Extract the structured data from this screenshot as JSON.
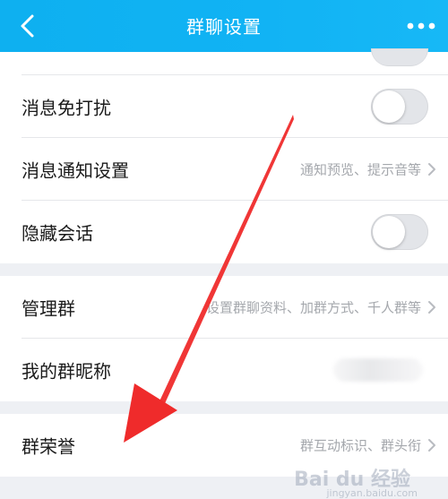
{
  "header": {
    "title": "群聊设置",
    "back_icon": "chevron-left-icon",
    "more_icon": "more-dots-icon"
  },
  "rows": {
    "dnd": {
      "label": "消息免打扰",
      "toggle_on": false
    },
    "notify": {
      "label": "消息通知设置",
      "sub": "通知预览、提示音等"
    },
    "hide": {
      "label": "隐藏会话",
      "toggle_on": false
    },
    "manage": {
      "label": "管理群",
      "sub": "设置群聊资料、加群方式、千人群等"
    },
    "nickname": {
      "label": "我的群昵称"
    },
    "honor": {
      "label": "群荣誉",
      "sub": "群互动标识、群头衔"
    }
  },
  "watermark": {
    "text": "Bai du 经验",
    "sub": "jingyan.baidu.com"
  },
  "colors": {
    "header": "#11b3f4",
    "arrow": "#ef2b2b",
    "background": "#eef0f4"
  }
}
